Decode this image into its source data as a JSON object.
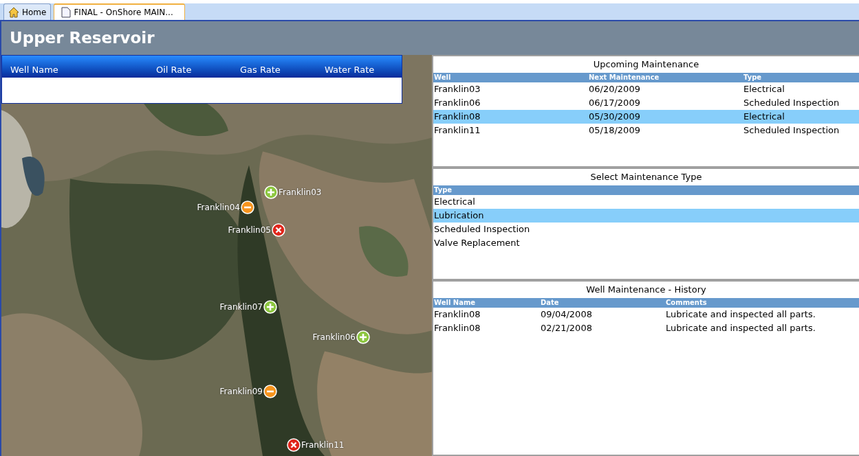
{
  "tabs": [
    {
      "label": "Home",
      "kind": "home",
      "selected": false
    },
    {
      "label": "FINAL - OnShore MAIN...",
      "kind": "document",
      "selected": true
    }
  ],
  "page_title": "Upper Reservoir",
  "well_grid": {
    "columns": [
      "Well Name",
      "Oil Rate",
      "Gas Rate",
      "Water Rate"
    ]
  },
  "map": {
    "markers": [
      {
        "label": "Franklin03",
        "kind": "ok"
      },
      {
        "label": "Franklin04",
        "kind": "warning"
      },
      {
        "label": "Franklin05",
        "kind": "alarm"
      },
      {
        "label": "Franklin07",
        "kind": "ok"
      },
      {
        "label": "Franklin06",
        "kind": "ok"
      },
      {
        "label": "Franklin09",
        "kind": "warning"
      },
      {
        "label": "Franklin11",
        "kind": "alarm"
      }
    ]
  },
  "upcoming_maintenance": {
    "title": "Upcoming Maintenance",
    "columns": [
      "Well",
      "Next Maintenance",
      "Type"
    ],
    "rows": [
      {
        "cells": [
          "Franklin03",
          "06/20/2009",
          "Electrical"
        ],
        "selected": false
      },
      {
        "cells": [
          "Franklin06",
          "06/17/2009",
          "Scheduled Inspection"
        ],
        "selected": false
      },
      {
        "cells": [
          "Franklin08",
          "05/30/2009",
          "Electrical"
        ],
        "selected": true
      },
      {
        "cells": [
          "Franklin11",
          "05/18/2009",
          "Scheduled Inspection"
        ],
        "selected": false
      }
    ]
  },
  "maintenance_type": {
    "title": "Select Maintenance Type",
    "columns": [
      "Type"
    ],
    "rows": [
      {
        "cells": [
          "Electrical"
        ],
        "selected": false
      },
      {
        "cells": [
          "Lubrication"
        ],
        "selected": true
      },
      {
        "cells": [
          "Scheduled Inspection"
        ],
        "selected": false
      },
      {
        "cells": [
          "Valve Replacement"
        ],
        "selected": false
      }
    ]
  },
  "maintenance_history": {
    "title": "Well Maintenance - History",
    "columns": [
      "Well Name",
      "Date",
      "Comments"
    ],
    "rows": [
      {
        "cells": [
          "Franklin08",
          "09/04/2008",
          "Lubricate and inspected all parts."
        ],
        "selected": false
      },
      {
        "cells": [
          "Franklin08",
          "02/21/2008",
          "Lubricate and inspected all parts."
        ],
        "selected": false
      }
    ]
  }
}
